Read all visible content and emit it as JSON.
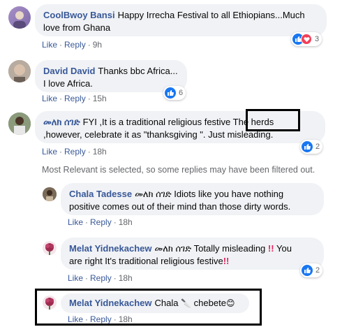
{
  "comments": [
    {
      "author": "CoolBwoy Bansi",
      "text": "Happy Irrecha Festival to all Ethiopians...Much love from Ghana",
      "like": "Like",
      "reply": "Reply",
      "time": "9h",
      "reaction_count": "3",
      "reactions": [
        "like-icon",
        "love-icon"
      ]
    },
    {
      "author": "David David",
      "text_line1": "Thanks bbc Africa...",
      "text_line2": "I love Africa.",
      "like": "Like",
      "reply": "Reply",
      "time": "15h",
      "reaction_count": "6",
      "reactions": [
        "like-icon"
      ]
    },
    {
      "author": "መለክ ሰገድ",
      "text_before": "FYI ,It is a traditional religious festive ",
      "text_boxed": "The herds",
      "text_after": ",however, celebrate it as \"thanksgiving \". Just misleading.",
      "like": "Like",
      "reply": "Reply",
      "time": "18h",
      "reaction_count": "2",
      "reactions": [
        "like-icon"
      ]
    }
  ],
  "filter_notice": "Most Relevant is selected, so some replies may have been filtered out.",
  "replies": [
    {
      "author": "Chala Tadesse",
      "text_line1": "መለክ ሰገድ Idiots like you have nothing",
      "text_line2": "positive comes out of their mind than those dirty words.",
      "like": "Like",
      "reply": "Reply",
      "time": "18h"
    },
    {
      "author": "Melat Yidnekachew",
      "text_line1": "መለክ ሰገድ Totally misleading",
      "text_line1_end": "You",
      "text_line2": "are right It's traditional religious festive",
      "emoji_mark": "‼️",
      "like": "Like",
      "reply": "Reply",
      "time": "18h",
      "reaction_count": "2",
      "reactions": [
        "like-icon"
      ]
    },
    {
      "author": "Melat Yidnekachew",
      "text": "Chala",
      "emoji_knife": "🔪",
      "text_after": "chebete",
      "emoji_smile": "😊",
      "like": "Like",
      "reply": "Reply",
      "time": "18h"
    }
  ],
  "colors": {
    "link": "#385898",
    "bubble": "#f0f2f5",
    "meta": "#65676b",
    "like_blue": "#1877f2",
    "love_red": "#f33e58"
  }
}
